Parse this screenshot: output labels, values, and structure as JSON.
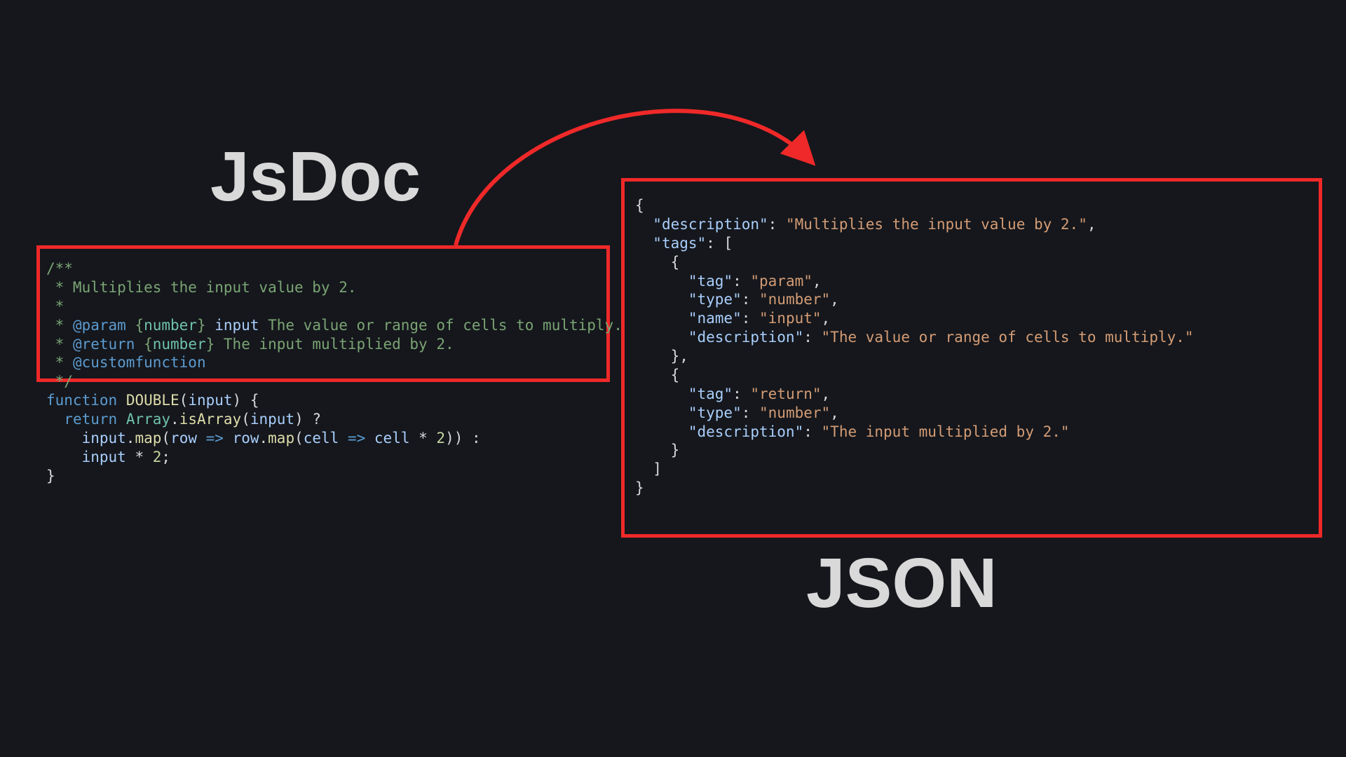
{
  "headings": {
    "jsdoc": "JsDoc",
    "json": "JSON"
  },
  "colors": {
    "arrow": "#ef2929",
    "border": "#ef2929",
    "bg": "#15171c",
    "heading": "#d9d9d9"
  },
  "jsdoc": {
    "comment_open": "/**",
    "line_desc": " * Multiplies the input value by 2.",
    "line_blank": " *",
    "line_param_prefix": " * ",
    "tag_param": "@param",
    "param_type_open": " {",
    "param_type": "number",
    "param_type_close": "} ",
    "param_name": "input",
    "param_desc": " The value or range of cells to multiply.",
    "tag_return": "@return",
    "return_type_open": " {",
    "return_type": "number",
    "return_type_close": "} ",
    "return_desc": "The input multiplied by 2.",
    "tag_custom": "@customfunction",
    "comment_close": " */",
    "kw_function": "function",
    "space1": " ",
    "fn_name": "DOUBLE",
    "paren_open": "(",
    "arg_input": "input",
    "paren_close_brace": ") {",
    "indent1": "  ",
    "kw_return": "return",
    "array_class": "Array",
    "dot": ".",
    "isArray": "isArray",
    "call_open": "(",
    "call_close_q": ") ?",
    "indent2": "    ",
    "input_map": "input",
    "map1": "map",
    "row": "row",
    "arrow": " => ",
    "row2": "row",
    "map2": "map",
    "cell": "cell",
    "cell2": "cell",
    "star": " * ",
    "two": "2",
    "close_map": ")) :",
    "input2": "input",
    "two2": "2",
    "semi": ";",
    "brace_close": "}"
  },
  "json": {
    "open": "{",
    "k_description": "\"description\"",
    "colon": ": ",
    "v_description": "\"Multiplies the input value by 2.\"",
    "comma": ",",
    "k_tags": "\"tags\"",
    "arr_open": "[",
    "obj_open": "{",
    "k_tag": "\"tag\"",
    "v_param": "\"param\"",
    "k_type": "\"type\"",
    "v_number": "\"number\"",
    "k_name": "\"name\"",
    "v_input": "\"input\"",
    "v_param_desc": "\"The value or range of cells to multiply.\"",
    "obj_close": "}",
    "obj_close_comma": "},",
    "v_return": "\"return\"",
    "v_return_desc": "\"The input multiplied by 2.\"",
    "arr_close": "]",
    "close": "}",
    "ind1": "  ",
    "ind2": "    ",
    "ind3": "      "
  }
}
